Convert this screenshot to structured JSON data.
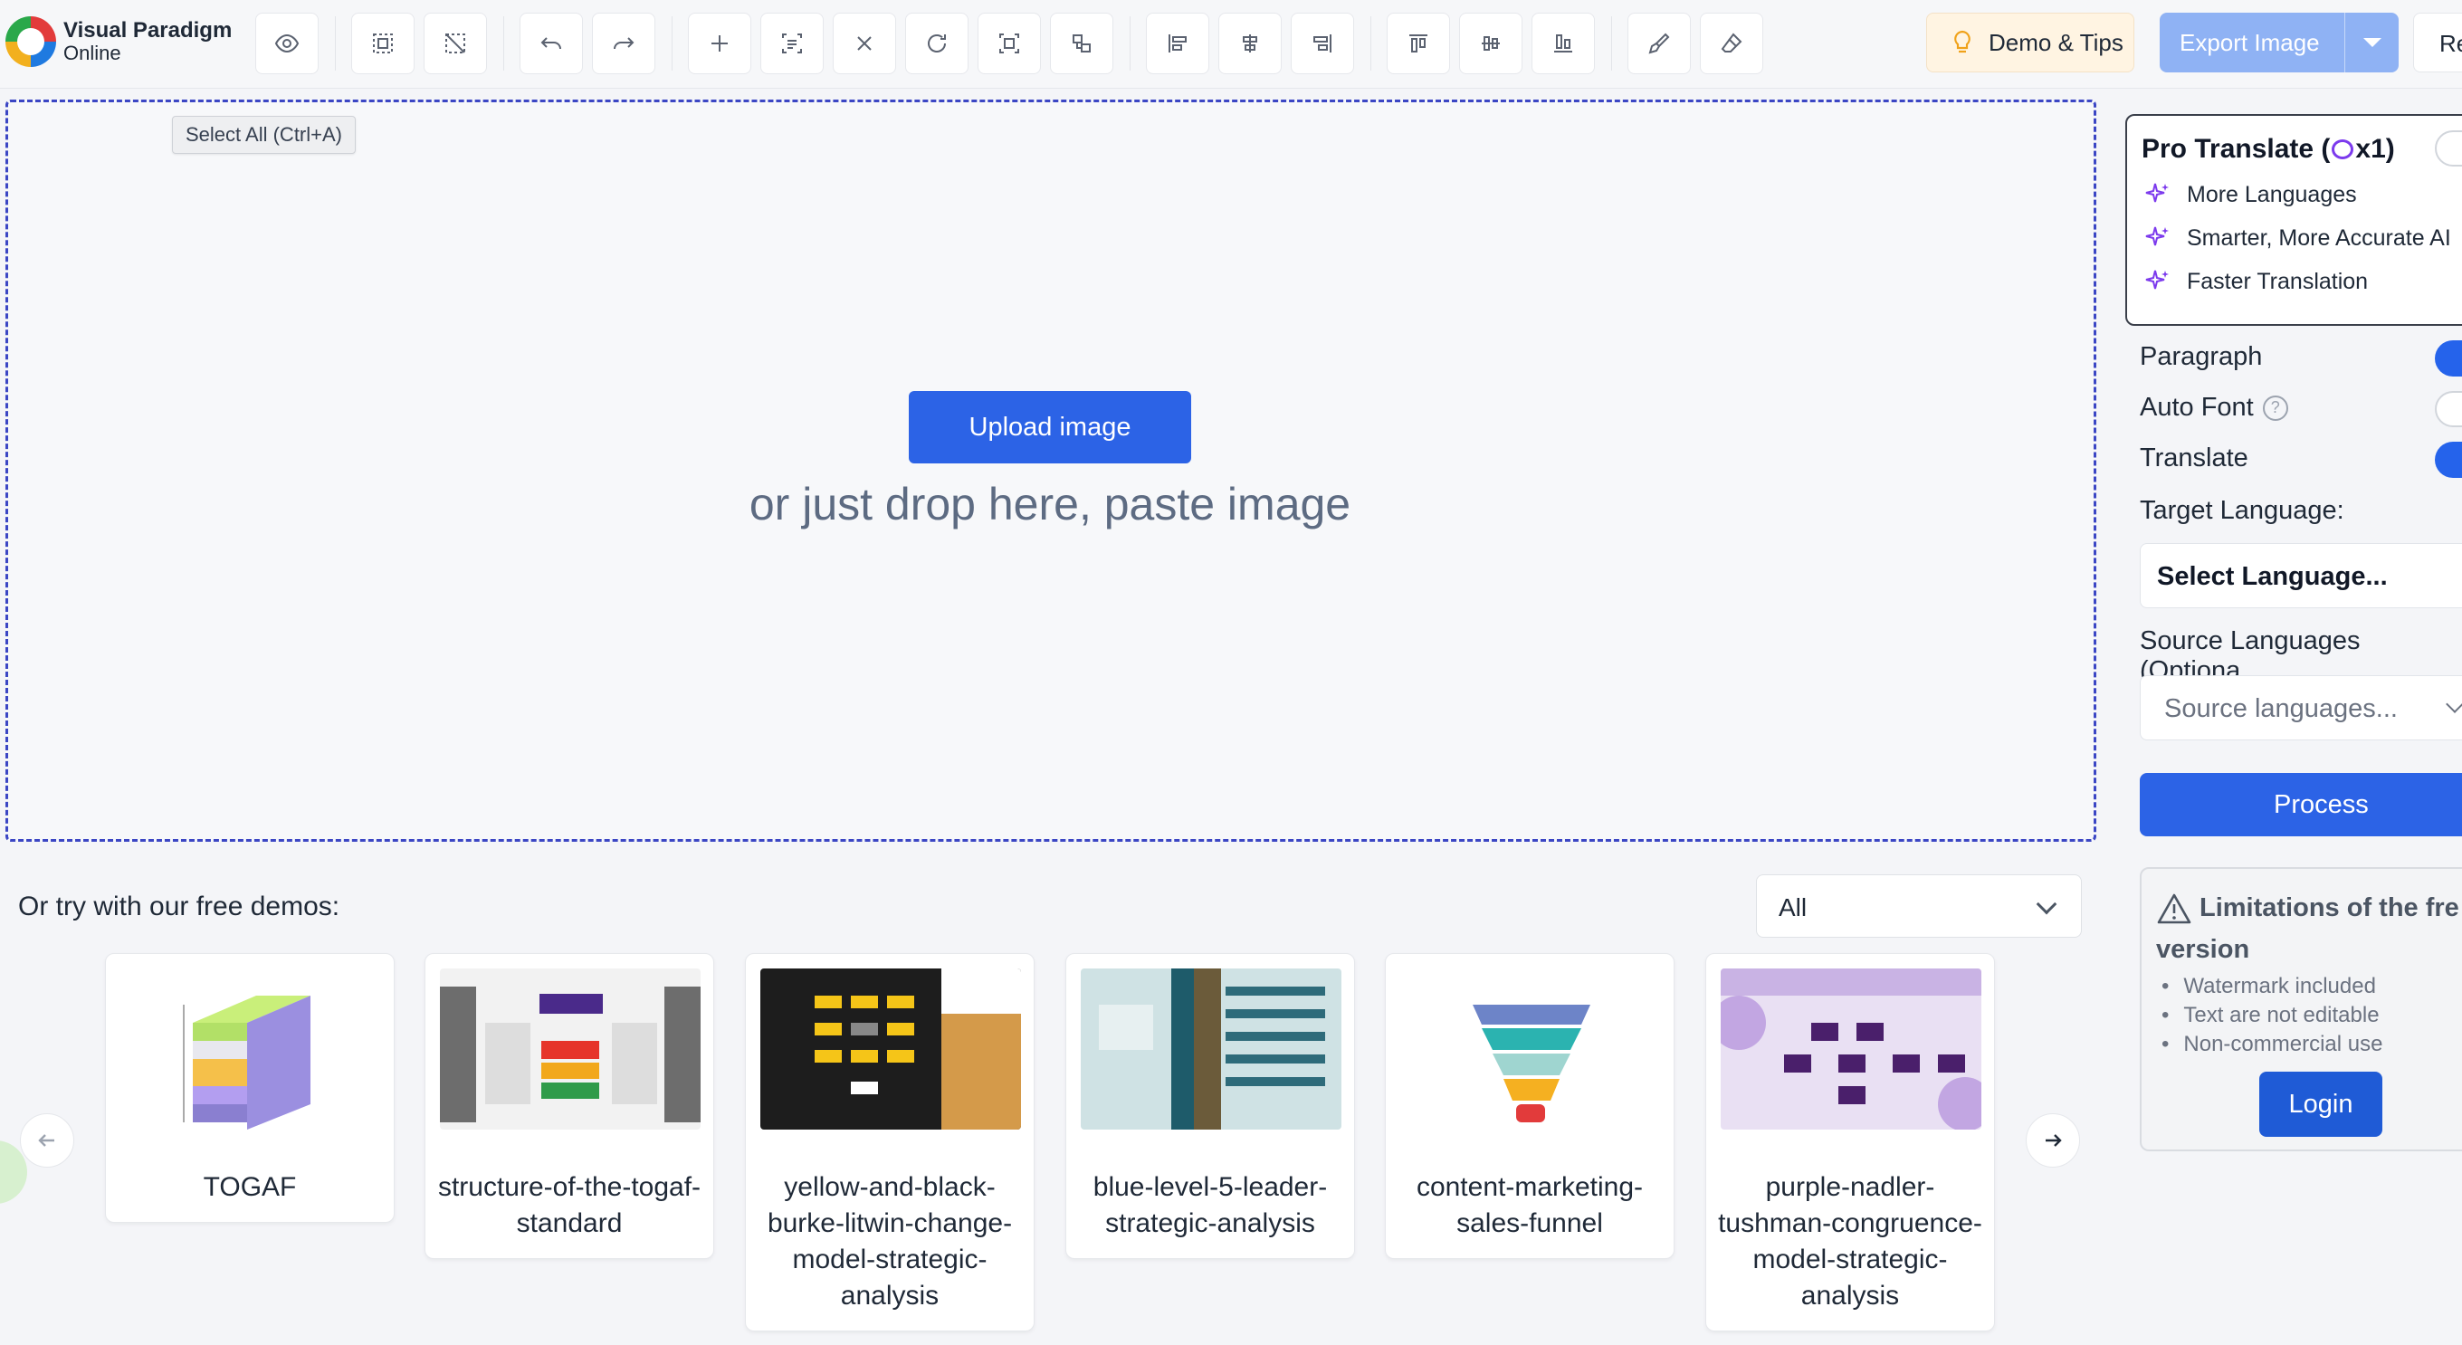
{
  "app": {
    "logo_line1": "Visual Paradigm",
    "logo_line2": "Online"
  },
  "toolbar": {
    "buttons": [
      "eye-icon",
      "select-all-icon",
      "deselect-icon",
      "undo-icon",
      "redo-icon",
      "add-icon",
      "text-detect-icon",
      "close-icon",
      "refresh-icon",
      "scan-icon",
      "group-icon",
      "align-left-icon",
      "align-center-icon",
      "align-right-icon",
      "align-top-icon",
      "align-middle-icon",
      "align-bottom-icon",
      "brush-icon",
      "eraser-icon"
    ],
    "demo_tips_label": "Demo & Tips",
    "export_label": "Export Image",
    "re_label": "Re"
  },
  "canvas": {
    "tooltip": "Select All (Ctrl+A)",
    "upload_label": "Upload image",
    "drop_text": "or just drop here, paste image"
  },
  "demos": {
    "label": "Or try with our free demos:",
    "filter_value": "All",
    "items": [
      {
        "title": "TOGAF"
      },
      {
        "title": "structure-of-the-togaf-standard"
      },
      {
        "title": "yellow-and-black-burke-litwin-change-model-strategic-analysis"
      },
      {
        "title": "blue-level-5-leader-strategic-analysis"
      },
      {
        "title": "content-marketing-sales-funnel"
      },
      {
        "title": "purple-nadler-tushman-congruence-model-strategic-analysis"
      }
    ]
  },
  "panel": {
    "pro_title_pre": "Pro Translate (",
    "pro_title_post": "x1)",
    "pro_features": [
      "More Languages",
      "Smarter, More Accurate AI",
      "Faster Translation"
    ],
    "paragraph_label": "Paragraph",
    "paragraph_on": true,
    "auto_font_label": "Auto Font",
    "auto_font_on": false,
    "translate_label": "Translate",
    "translate_on": true,
    "target_language_label": "Target Language:",
    "target_language_value": "Select Language...",
    "source_languages_label": "Source Languages (Optiona",
    "source_languages_placeholder": "Source languages...",
    "process_label": "Process",
    "limits_title": "Limitations of the fre version",
    "limits": [
      "Watermark included",
      "Text are not editable",
      "Non-commercial use"
    ],
    "login_label": "Login"
  },
  "colors": {
    "primary": "#2c63e6",
    "export_disabled": "#8fb2f4",
    "tips_bg": "#fff4e2",
    "dropzone_border": "#3b46c4",
    "spark": "#7c3aed"
  }
}
